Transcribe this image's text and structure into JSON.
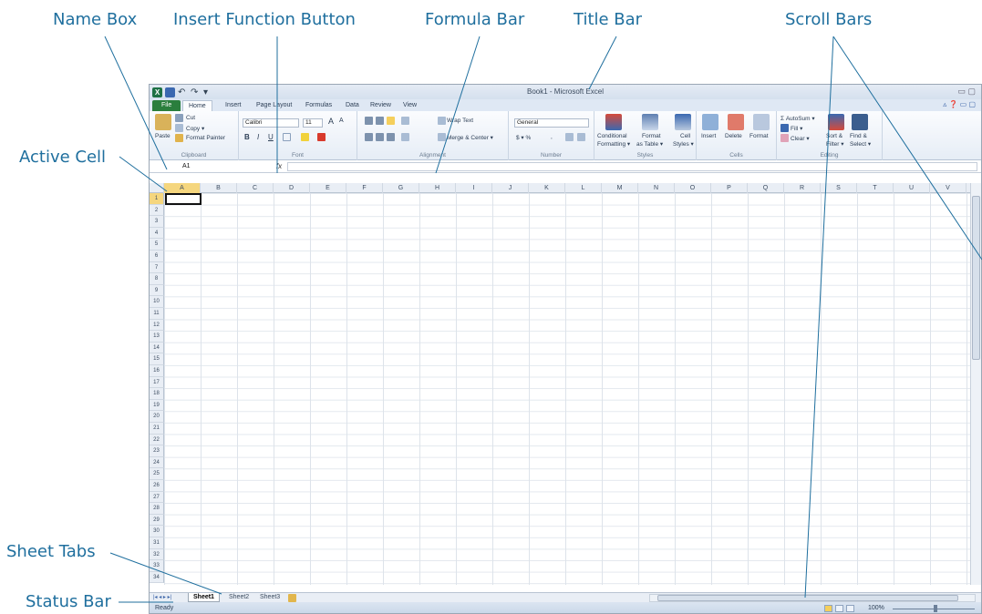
{
  "callouts": {
    "name_box": "Name Box",
    "insert_function": "Insert Function Button",
    "formula_bar": "Formula Bar",
    "title_bar": "Title Bar",
    "scroll_bars": "Scroll Bars",
    "active_cell": "Active Cell",
    "sheet_tabs": "Sheet Tabs",
    "status_bar": "Status Bar"
  },
  "window": {
    "title": "Book1 - Microsoft Excel",
    "qat_undo": "↶",
    "qat_redo": "↷",
    "qat_custom": "▾",
    "app_icon": "X",
    "controls": "▭ ▢"
  },
  "tabs": [
    "File",
    "Home",
    "Insert",
    "Page Layout",
    "Formulas",
    "Data",
    "Review",
    "View"
  ],
  "help_controls": "▵ ❓ ▭ ▢",
  "ribbon": {
    "clipboard": {
      "label": "Clipboard",
      "paste": "Paste",
      "cut": "Cut",
      "copy": "Copy ▾",
      "format_painter": "Format Painter"
    },
    "font": {
      "label": "Font",
      "name": "Calibri",
      "size": "11",
      "grow": "A",
      "shrink": "A",
      "bold": "B",
      "italic": "I",
      "underline": "U"
    },
    "alignment": {
      "label": "Alignment",
      "wrap": "Wrap Text",
      "merge": "Merge & Center ▾"
    },
    "number": {
      "label": "Number",
      "format": "General",
      "currency": "$ ▾ %",
      "comma": ","
    },
    "styles": {
      "label": "Styles",
      "conditional": "Conditional",
      "conditional2": "Formatting ▾",
      "format_table": "Format",
      "format_table2": "as Table ▾",
      "cell_styles": "Cell",
      "cell_styles2": "Styles ▾"
    },
    "cells": {
      "label": "Cells",
      "insert": "Insert",
      "delete": "Delete",
      "format": "Format"
    },
    "editing": {
      "label": "Editing",
      "autosum": "Σ AutoSum ▾",
      "fill": "Fill ▾",
      "clear": "Clear ▾",
      "sort": "Sort &",
      "sort2": "Filter ▾",
      "find": "Find &",
      "find2": "Select ▾"
    }
  },
  "formula_bar": {
    "name_box": "A1",
    "fx": "fx",
    "value": ""
  },
  "columns": [
    "A",
    "B",
    "C",
    "D",
    "E",
    "F",
    "G",
    "H",
    "I",
    "J",
    "K",
    "L",
    "M",
    "N",
    "O",
    "P",
    "Q",
    "R",
    "S",
    "T",
    "U",
    "V"
  ],
  "rows": [
    "1",
    "2",
    "3",
    "4",
    "5",
    "6",
    "7",
    "8",
    "9",
    "10",
    "11",
    "12",
    "13",
    "14",
    "15",
    "16",
    "17",
    "18",
    "19",
    "20",
    "21",
    "22",
    "23",
    "24",
    "25",
    "26",
    "27",
    "28",
    "29",
    "30",
    "31",
    "32",
    "33",
    "34"
  ],
  "active_cell": "A1",
  "sheets": [
    "Sheet1",
    "Sheet2",
    "Sheet3"
  ],
  "sheet_nav": "|◂ ◂ ▸ ▸|",
  "status": {
    "ready": "Ready",
    "zoom": "100%"
  },
  "colors": {
    "callout": "#1f6f9e",
    "file_tab": "#2a7e3d",
    "selection_header": "#f5d67e"
  }
}
